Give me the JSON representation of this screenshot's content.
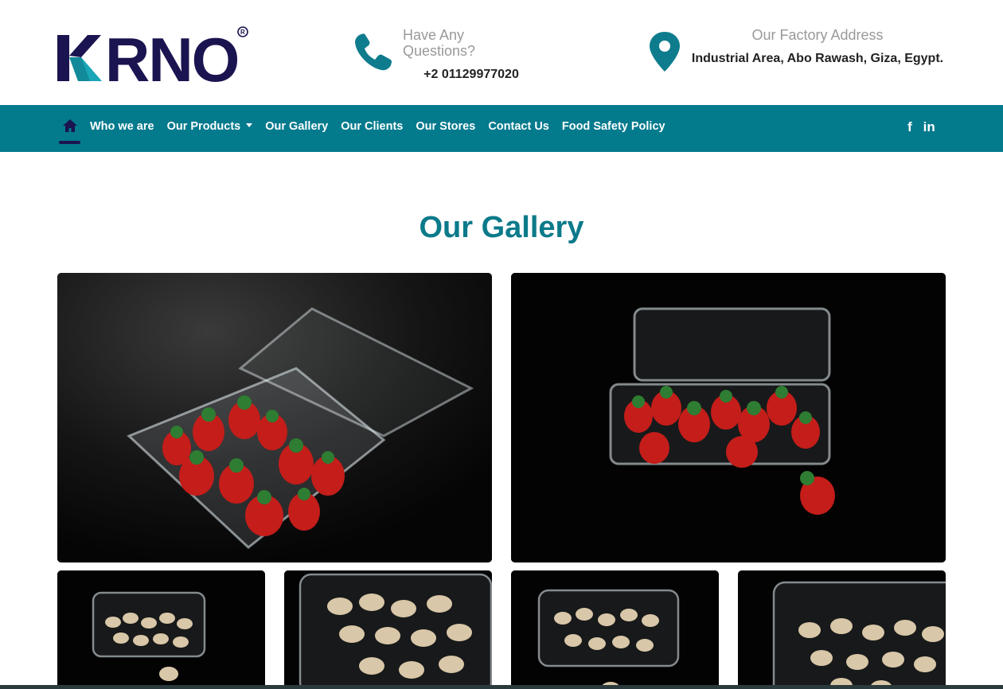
{
  "header": {
    "logo_text": "KRNO",
    "phone": {
      "label": "Have Any Questions?",
      "value": "+2 01129977020",
      "icon": "phone-icon"
    },
    "address": {
      "label": "Our Factory Address",
      "value": "Industrial Area, Abo Rawash, Giza, Egypt.",
      "icon": "map-pin-icon"
    }
  },
  "nav": {
    "home_icon": "home-icon",
    "items": [
      {
        "label": "Who we are"
      },
      {
        "label": "Our Products",
        "has_dropdown": true
      },
      {
        "label": "Our Gallery"
      },
      {
        "label": "Our Clients"
      },
      {
        "label": "Our Stores"
      },
      {
        "label": "Contact Us"
      },
      {
        "label": "Food Safety Policy"
      }
    ],
    "social": {
      "facebook": "f",
      "linkedin": "in"
    }
  },
  "gallery": {
    "title": "Our Gallery",
    "photos": [
      {
        "subject": "strawberries in clamshell container"
      },
      {
        "subject": "strawberries in clamshell container"
      },
      {
        "subject": "pistachios in container"
      },
      {
        "subject": "pistachios in container"
      },
      {
        "subject": "pistachios in container"
      },
      {
        "subject": "pistachios in container"
      }
    ]
  },
  "colors": {
    "nav_bg": "#047a8d",
    "title": "#0c7a8a",
    "logo_navy": "#1a1450",
    "logo_teal": "#1aa6b7",
    "icon_teal": "#0e7c8c"
  }
}
